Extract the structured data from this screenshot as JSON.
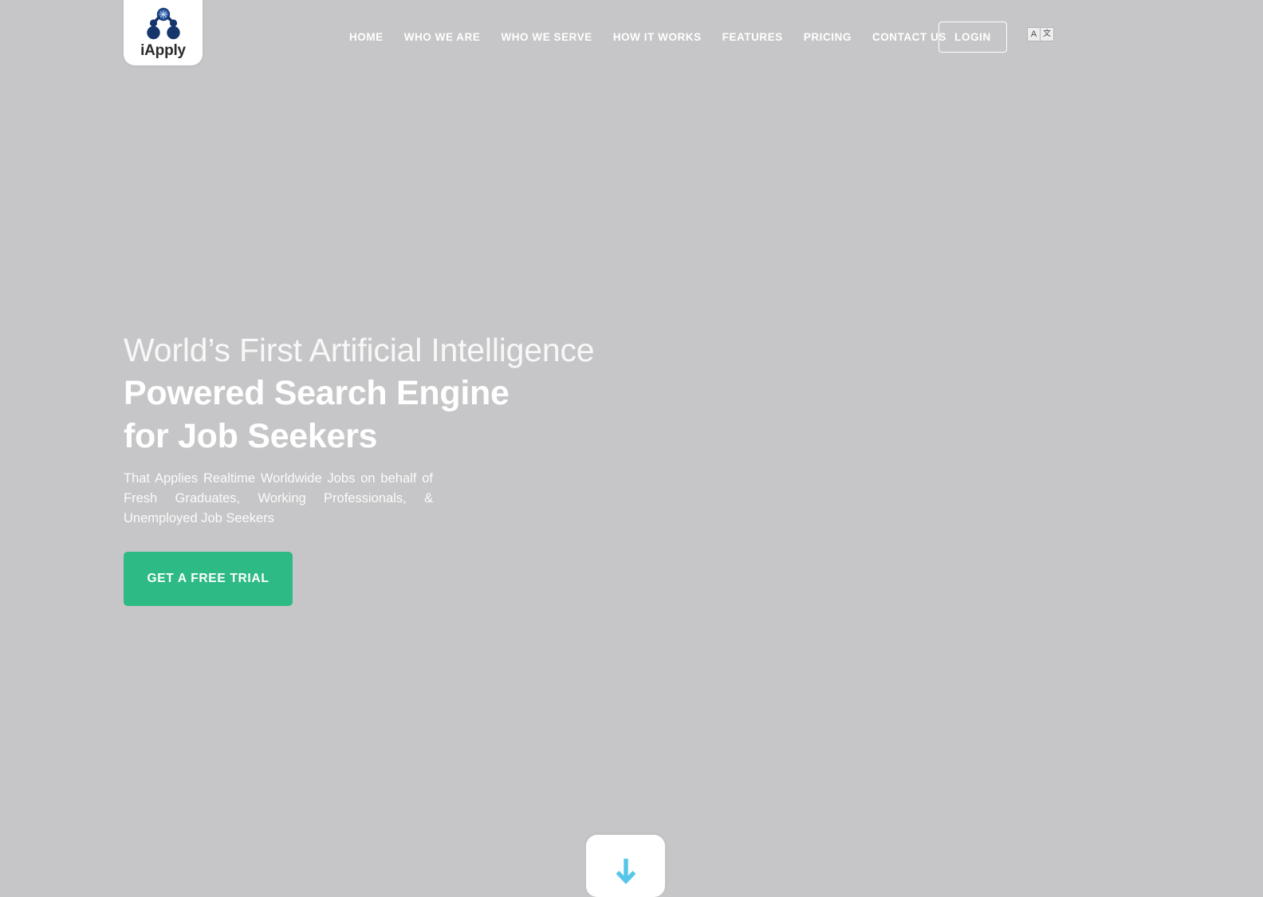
{
  "site": {
    "background_color": "#c6c6c8",
    "accent_green": "#2dba85",
    "accent_blue": "#55c6e8"
  },
  "header": {
    "logo": {
      "icon": "molecule-network-icon",
      "wordmark": "iApply"
    },
    "nav_items": [
      {
        "label": "HOME",
        "name": "nav-item-home"
      },
      {
        "label": "WHO WE ARE",
        "name": "nav-item-who-we-are"
      },
      {
        "label": "WHO WE SERVE",
        "name": "nav-item-who-we-serve"
      },
      {
        "label": "HOW IT WORKS",
        "name": "nav-item-how-it-works"
      },
      {
        "label": "FEATURES",
        "name": "nav-item-features"
      },
      {
        "label": "PRICING",
        "name": "nav-item-pricing"
      },
      {
        "label": "CONTACT US",
        "name": "nav-item-contact-us"
      }
    ],
    "login_label": "LOGIN",
    "translate": {
      "latin_glyph": "A",
      "cjk_glyph": "文"
    }
  },
  "hero": {
    "headline_line_1": "World’s First Artificial Intelligence",
    "headline_line_2": "Powered Search Engine",
    "headline_line_3": "for Job Seekers",
    "subtext": "That Applies Realtime Worldwide Jobs on behalf of Fresh Graduates, Working Professionals, & Unemployed Job Seekers",
    "cta_label": "GET A FREE TRIAL"
  },
  "scroll_indicator": {
    "icon": "arrow-down-icon"
  }
}
